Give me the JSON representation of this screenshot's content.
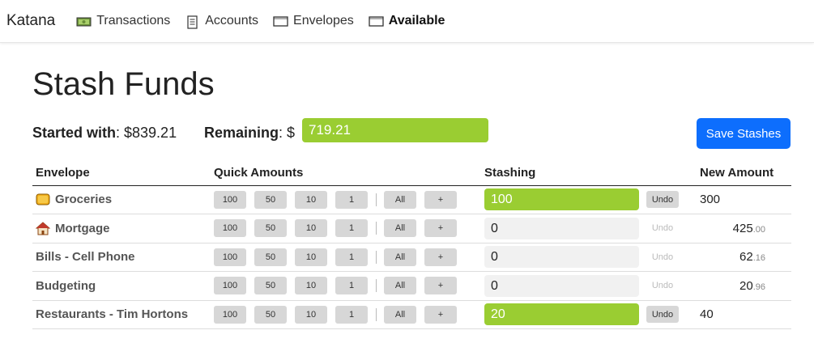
{
  "nav": {
    "brand": "Katana",
    "items": [
      {
        "label": "Transactions",
        "icon": "money-icon"
      },
      {
        "label": "Accounts",
        "icon": "ledger-icon"
      },
      {
        "label": "Envelopes",
        "icon": "envelope-icon"
      },
      {
        "label": "Available",
        "icon": "envelope-icon"
      }
    ]
  },
  "page": {
    "title": "Stash Funds",
    "started_label": "Started with",
    "started_value": ": $839.21",
    "remaining_label": "Remaining",
    "remaining_prefix": ": $",
    "remaining_value": "719.21",
    "save_label": "Save Stashes"
  },
  "table": {
    "headers": {
      "envelope": "Envelope",
      "quick": "Quick Amounts",
      "stashing": "Stashing",
      "new_amount": "New Amount"
    },
    "quick_amounts": [
      "100",
      "50",
      "10",
      "1",
      "All",
      "+"
    ],
    "undo_label": "Undo",
    "rows": [
      {
        "name": "Groceries",
        "icon": "cheese-icon",
        "stash": "100",
        "new_whole": "300",
        "new_cents": ""
      },
      {
        "name": "Mortgage",
        "icon": "house-icon",
        "stash": "0",
        "new_whole": "425",
        "new_cents": ".00"
      },
      {
        "name": "Bills - Cell Phone",
        "icon": "",
        "stash": "0",
        "new_whole": "62",
        "new_cents": ".16"
      },
      {
        "name": "Budgeting",
        "icon": "",
        "stash": "0",
        "new_whole": "20",
        "new_cents": ".96"
      },
      {
        "name": "Restaurants - Tim Hortons",
        "icon": "",
        "stash": "20",
        "new_whole": "40",
        "new_cents": ""
      }
    ]
  },
  "colors": {
    "accent_green": "#9acd32",
    "primary_blue": "#0d6efd"
  }
}
